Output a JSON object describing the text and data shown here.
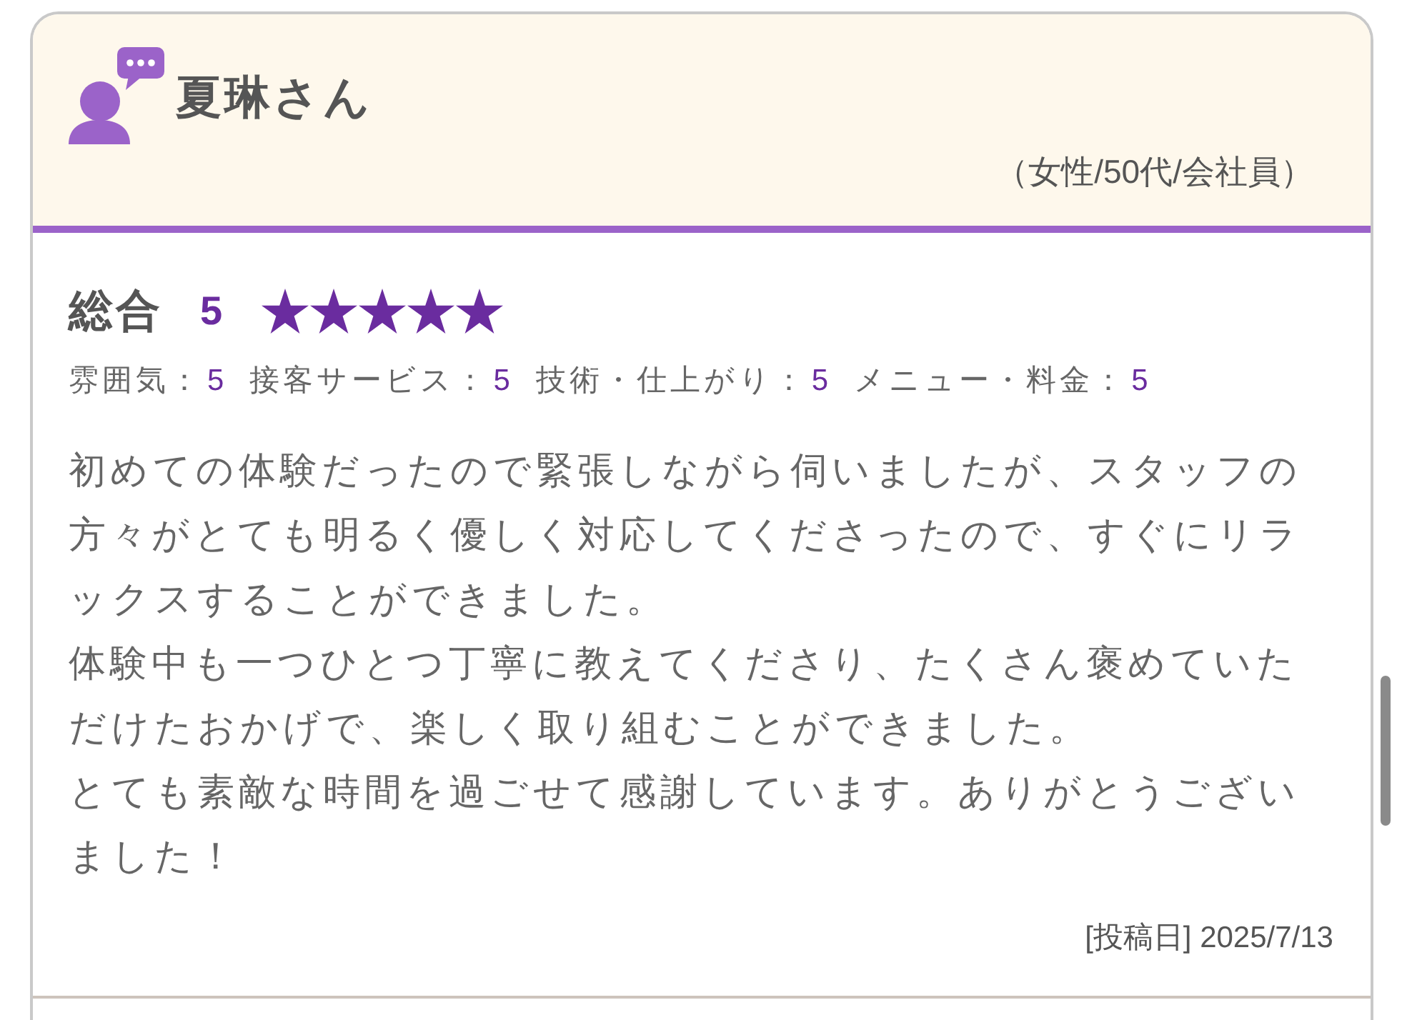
{
  "reviewer": {
    "name": "夏琳さん",
    "profile": "（女性/50代/会社員）"
  },
  "overall": {
    "label": "総合",
    "score": "5",
    "stars": 5
  },
  "ratings": [
    {
      "label": "雰囲気：",
      "value": "5"
    },
    {
      "label": "接客サービス：",
      "value": "5"
    },
    {
      "label": "技術・仕上がり：",
      "value": "5"
    },
    {
      "label": "メニュー・料金：",
      "value": "5"
    }
  ],
  "review": {
    "paragraphs": [
      "初めての体験だったので緊張しながら伺いましたが、スタッフの方々がとても明るく優しく対応してくださったので、すぐにリラックスすることができました。",
      "体験中も一つひとつ丁寧に教えてくださり、たくさん褒めていただけたおかげで、楽しく取り組むことができました。",
      "とても素敵な時間を過ごせて感謝しています。ありがとうございました！"
    ],
    "posted": "[投稿日] 2025/7/13"
  }
}
